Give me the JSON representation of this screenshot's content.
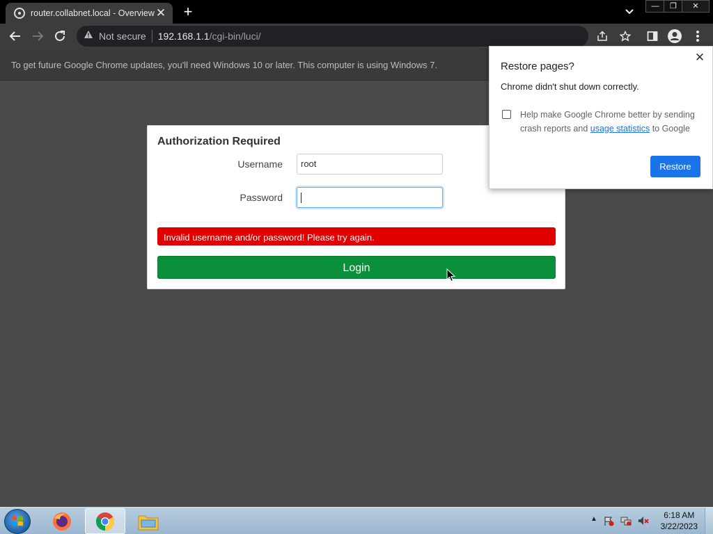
{
  "browser": {
    "tab": {
      "title": "router.collabnet.local - Overview",
      "close_glyph": "✕"
    },
    "new_tab_glyph": "+",
    "window_controls": {
      "minimize": "—",
      "maximize": "❐",
      "close": "✕"
    },
    "address": {
      "security_label": "Not secure",
      "host": "192.168.1.1",
      "path": "/cgi-bin/luci/"
    },
    "infobar_text": "To get future Google Chrome updates, you'll need Windows 10 or later. This computer is using Windows 7."
  },
  "login": {
    "title": "Authorization Required",
    "username_label": "Username",
    "username_value": "root",
    "password_label": "Password",
    "password_value": "",
    "error_message": "Invalid username and/or password! Please try again.",
    "login_button": "Login"
  },
  "restore_popup": {
    "title": "Restore pages?",
    "message": "Chrome didn't shut down correctly.",
    "consent_prefix": "Help make Google Chrome better by sending crash reports and ",
    "consent_link": "usage statistics",
    "consent_suffix": " to Google",
    "consent_checked": false,
    "close_glyph": "✕",
    "restore_button": "Restore"
  },
  "taskbar": {
    "apps": [
      "firefox-icon",
      "chrome-icon",
      "file-explorer-icon"
    ],
    "active_app": "chrome-icon",
    "tray_expand_glyph": "▲",
    "clock_time": "6:18 AM",
    "clock_date": "3/22/2023"
  },
  "colors": {
    "error": "#e00000",
    "login_button": "#0a8f3a",
    "restore_button": "#1a73e8",
    "link": "#1a73e8",
    "page_background": "#4a4a4a"
  }
}
